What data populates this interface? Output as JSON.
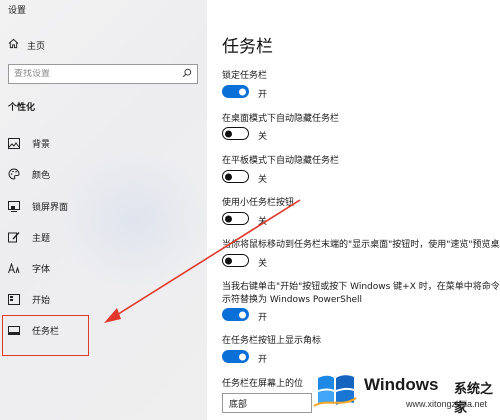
{
  "window": {
    "title": "设置"
  },
  "sidebar": {
    "home_label": "主页",
    "search_placeholder": "查找设置",
    "section_title": "个性化",
    "items": [
      {
        "label": "背景",
        "icon": "image-icon"
      },
      {
        "label": "颜色",
        "icon": "palette-icon"
      },
      {
        "label": "锁屏界面",
        "icon": "lock-screen-icon"
      },
      {
        "label": "主题",
        "icon": "theme-brush-icon"
      },
      {
        "label": "字体",
        "icon": "font-icon"
      },
      {
        "label": "开始",
        "icon": "start-icon"
      },
      {
        "label": "任务栏",
        "icon": "taskbar-icon",
        "selected": true
      }
    ]
  },
  "main": {
    "title": "任务栏",
    "settings": [
      {
        "label": "锁定任务栏",
        "state": "开",
        "on": true
      },
      {
        "label": "在桌面模式下自动隐藏任务栏",
        "state": "关",
        "on": false
      },
      {
        "label": "在平板模式下自动隐藏任务栏",
        "state": "关",
        "on": false
      },
      {
        "label": "使用小任务栏按钮",
        "state": "关",
        "on": false
      },
      {
        "label": "当你将鼠标移动到任务栏末端的\"显示桌面\"按钮时，使用\"速览\"预览桌",
        "state": "关",
        "on": false
      },
      {
        "label": "当我右键单击\"开始\"按钮或按下 Windows 键+X 时，在菜单中将命令提",
        "label2": "示符替换为 Windows PowerShell",
        "state": "开",
        "on": true
      },
      {
        "label": "在任务栏按钮上显示角标",
        "state": "开",
        "on": true
      }
    ],
    "position_label": "任务栏在屏幕上的位",
    "position_value": "底部"
  },
  "watermark": {
    "brand": "Windows",
    "cn": "系统之家",
    "url": "www.xitongzhijia.net"
  },
  "colors": {
    "accent": "#0a6fd6",
    "highlight": "#e0392b"
  }
}
